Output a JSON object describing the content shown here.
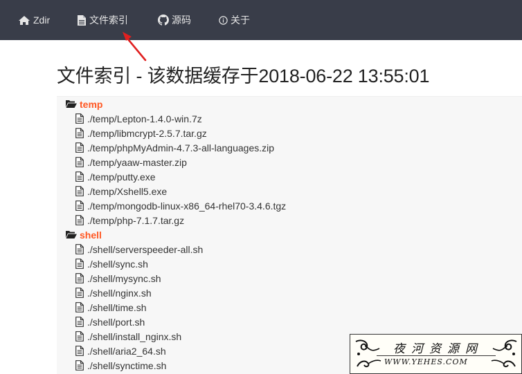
{
  "nav": {
    "home_label": "Zdir",
    "index_label": "文件索引",
    "source_label": "源码",
    "about_label": "关于"
  },
  "page": {
    "title": "文件索引 - 该数据缓存于2018-06-22 13:55:01"
  },
  "colors": {
    "navbar_bg": "#393d49",
    "folder_label": "#ff5722",
    "arrow": "#e02020"
  },
  "directories": [
    {
      "name": "temp",
      "files": [
        "./temp/Lepton-1.4.0-win.7z",
        "./temp/libmcrypt-2.5.7.tar.gz",
        "./temp/phpMyAdmin-4.7.3-all-languages.zip",
        "./temp/yaaw-master.zip",
        "./temp/putty.exe",
        "./temp/Xshell5.exe",
        "./temp/mongodb-linux-x86_64-rhel70-3.4.6.tgz",
        "./temp/php-7.1.7.tar.gz"
      ]
    },
    {
      "name": "shell",
      "files": [
        "./shell/serverspeeder-all.sh",
        "./shell/sync.sh",
        "./shell/mysync.sh",
        "./shell/nginx.sh",
        "./shell/time.sh",
        "./shell/port.sh",
        "./shell/install_nginx.sh",
        "./shell/aria2_64.sh",
        "./shell/synctime.sh"
      ]
    }
  ],
  "watermark": {
    "text": "夜河资源网",
    "url": "WWW.YEHES.COM"
  }
}
